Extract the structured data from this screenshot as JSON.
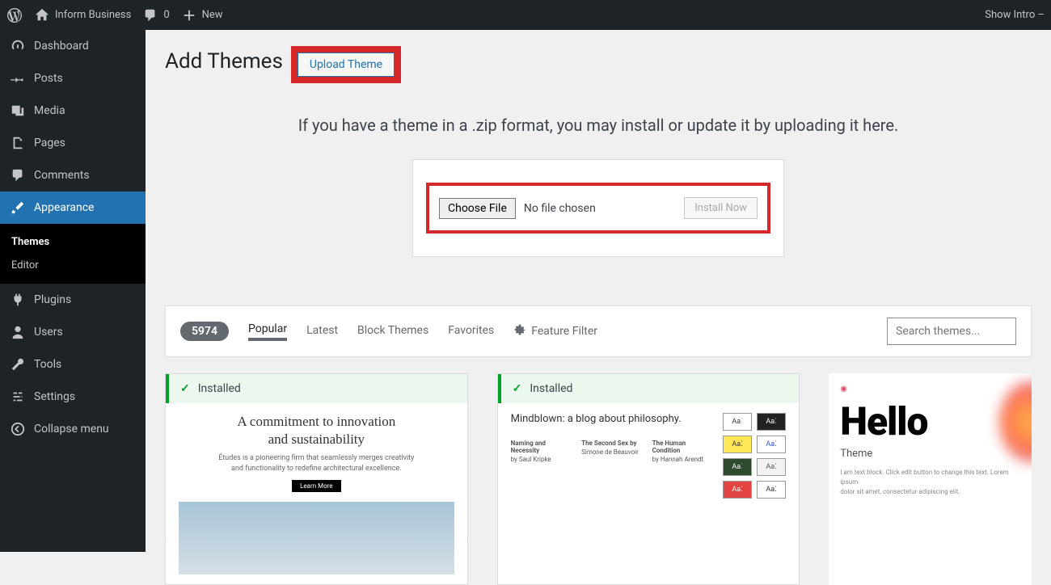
{
  "adminbar": {
    "site_name": "Inform Business",
    "comments_count": "0",
    "new_label": "New",
    "show_intro": "Show Intro –"
  },
  "sidebar": {
    "items": [
      {
        "label": "Dashboard"
      },
      {
        "label": "Posts"
      },
      {
        "label": "Media"
      },
      {
        "label": "Pages"
      },
      {
        "label": "Comments"
      },
      {
        "label": "Appearance"
      },
      {
        "label": "Plugins"
      },
      {
        "label": "Users"
      },
      {
        "label": "Tools"
      },
      {
        "label": "Settings"
      },
      {
        "label": "Collapse menu"
      }
    ],
    "submenu": [
      {
        "label": "Themes"
      },
      {
        "label": "Editor"
      }
    ]
  },
  "page": {
    "title": "Add Themes",
    "upload_button": "Upload Theme",
    "upload_help": "If you have a theme in a .zip format, you may install or update it by uploading it here.",
    "choose_file": "Choose File",
    "no_file": "No file chosen",
    "install_now": "Install Now"
  },
  "filter": {
    "count": "5974",
    "tabs": [
      "Popular",
      "Latest",
      "Block Themes",
      "Favorites"
    ],
    "feature_filter": "Feature Filter",
    "search_placeholder": "Search themes..."
  },
  "themes": {
    "installed_label": "Installed",
    "card1": {
      "title1": "A commitment to innovation",
      "title2": "and sustainability"
    },
    "card2": {
      "tagline": "Mindblown: a blog about philosophy.",
      "cols": [
        {
          "t": "Naming and Necessity",
          "s": "by Saul Kripke"
        },
        {
          "t": "The Second Sex by",
          "s": "Simone de Beauvoir"
        },
        {
          "t": "The Human Condition",
          "s": "by Hannah Arendt"
        }
      ],
      "swatch_label": "Aa"
    },
    "card3": {
      "hello": "Hello",
      "sub": "Theme"
    }
  }
}
